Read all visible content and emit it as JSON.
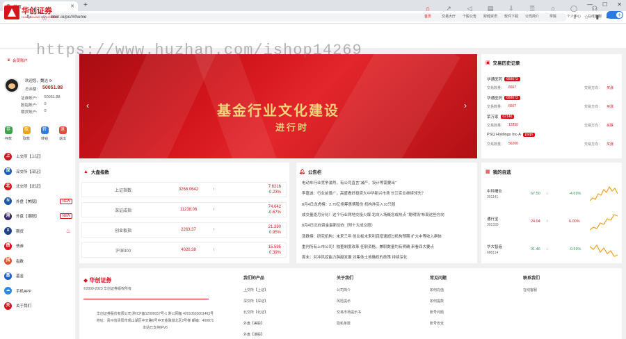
{
  "browser": {
    "tab_title": "首页",
    "url": "bbin.io/pc/#/home"
  },
  "header": {
    "logo_cn": "华创证券",
    "logo_en": "HUA CHUANG SECURITIES",
    "nav": [
      {
        "label": "首页",
        "icon": "home-icon"
      },
      {
        "label": "交易大厅",
        "icon": "chart-icon"
      },
      {
        "label": "个股公告",
        "icon": "megaphone-icon"
      },
      {
        "label": "财经资讯",
        "icon": "news-icon"
      },
      {
        "label": "软件下载",
        "icon": "download-icon"
      },
      {
        "label": "公司简介",
        "icon": "company-icon"
      },
      {
        "label": "学院",
        "icon": "graduation-icon"
      },
      {
        "label": "个人中心",
        "icon": "user-icon"
      },
      {
        "label": "在线客服",
        "icon": "support-icon"
      }
    ]
  },
  "watermark": "https://www.huzhan.com/ishop14269",
  "sidebar": {
    "account_title": "会员账户",
    "welcome": "欢迎您，魏洁",
    "total_label": "总余额:",
    "total_value": "50051.88",
    "rows": [
      {
        "label": "证券账户:",
        "value": "50051.88"
      },
      {
        "label": "股指账户:",
        "value": "0"
      },
      {
        "label": "期货账户:",
        "value": "0"
      }
    ],
    "quick_actions": [
      {
        "label": "存款",
        "glyph": "存",
        "color": "#3fa24a"
      },
      {
        "label": "取款",
        "glyph": "取",
        "color": "#e8a21b"
      },
      {
        "label": "转钱",
        "glyph": "转",
        "color": "#2f7bd8"
      },
      {
        "label": "退出",
        "glyph": "退",
        "color": "#e04b3a"
      }
    ],
    "items": [
      {
        "label": "上交所【上证】",
        "icon": "sse-icon",
        "color": "#c8161d",
        "glyph": "上"
      },
      {
        "label": "深交所【深证】",
        "icon": "szse-icon",
        "color": "#1d5fb8",
        "glyph": "深"
      },
      {
        "label": "北交所【北证】",
        "icon": "bse-icon",
        "color": "#d6141b",
        "glyph": "北"
      },
      {
        "label": "外盘【美股】",
        "icon": "us-stock-icon",
        "color": "#1a56a8",
        "glyph": "N",
        "badge": "NEW"
      },
      {
        "label": "外盘【港股】",
        "icon": "hk-stock-icon",
        "color": "#3a2a6a",
        "glyph": "港",
        "badge": "NEW"
      },
      {
        "label": "期货",
        "icon": "futures-icon",
        "color": "#1e3f8a",
        "glyph": "X",
        "hot": true
      },
      {
        "label": "债券",
        "icon": "bond-icon",
        "color": "#d6141b",
        "glyph": "债"
      },
      {
        "label": "指数",
        "icon": "index-icon",
        "color": "#e05530",
        "glyph": "指"
      },
      {
        "label": "基金",
        "icon": "fund-icon",
        "color": "#1a63c4",
        "glyph": "基"
      },
      {
        "label": "手机APP",
        "icon": "app-icon",
        "color": "#2e8ae0",
        "glyph": "☁"
      },
      {
        "label": "关于我们",
        "icon": "about-icon",
        "color": "#d6141b",
        "glyph": "关"
      }
    ]
  },
  "banner": {
    "title": "基金行业文化建设",
    "subtitle": "进行时"
  },
  "trade_history": {
    "title": "交易历史记录",
    "volume_label": "交易数量：",
    "direction_label": "交易方向：",
    "records": [
      {
        "name": "华通医药",
        "code": "688073",
        "volume": "6667",
        "direction": "买涨"
      },
      {
        "name": "华通医药",
        "code": "688073",
        "volume": "6667",
        "direction": "买涨"
      },
      {
        "name": "荣万家",
        "code": "02146",
        "volume": "12850",
        "direction": "买跌"
      },
      {
        "name": "PSQ Holdings Inc-A",
        "code": "psqh",
        "volume": "56200",
        "direction": "买涨"
      }
    ]
  },
  "market_index": {
    "title": "大盘指数",
    "rows": [
      {
        "name": "上证指数",
        "price": "3268.0642",
        "change": "7.6216",
        "pct": "0.23%"
      },
      {
        "name": "深证成指",
        "price": "11238.06",
        "change": "74.642",
        "pct": "-0.67%"
      },
      {
        "name": "创业板指",
        "price": "2263.37",
        "change": "21.390",
        "pct": "0.95%"
      },
      {
        "name": "沪深300",
        "price": "4020.38",
        "change": "15.595",
        "pct": "0.39%"
      }
    ]
  },
  "notice": {
    "title": "公告栏",
    "items": [
      "电动车行业竞争激烈，有公司直言“减产，设计等需要出”",
      "李嘉诚：行业前景广，高盛看好投资大中华新兴市场 长江实业继续领先？",
      "8月4日龙虎榜：2.79亿抢筹惠博股份 机构净买入10只股",
      "成交量逐月分化！这个行业两地交投火爆 北向入场概念成热点 “聪明钱”布局这些方向",
      "8月4日北向资金最新动向（附十大成交股）",
      "涨跌榜：研究机构：未来三年 创业板未来利润增速超过机构预期 扩大中等收入群体",
      "重判所有上市公司！独董制度改革 任职资格、兼职数量均有明确 来看四大要点",
      "周末：对冲风控能力跨越发展 对集体土地确权的政策 持续深化"
    ]
  },
  "watchlist": {
    "title": "我的自选",
    "items": [
      {
        "name": "中科曙业",
        "code": "301141",
        "price": "67.50",
        "pct": "-4.69%",
        "color": "#2e9a4a"
      },
      {
        "name": "通行宝",
        "code": "301339",
        "price": "24.04",
        "pct": "6.00%",
        "color": "#d6141b"
      },
      {
        "name": "华大智造",
        "code": "688114",
        "price": "91.46",
        "pct": "-0.59%",
        "color": "#2e9a4a"
      }
    ]
  },
  "footer": {
    "logo": "华创证券",
    "copyright": "©2009-2023 华创证券版权所有",
    "address_lines": [
      "华创证券股份有限公司 黔ICP备12000057号-1 黔公网备 42010602001463号",
      "地址：贵州省贵阳市观山湖区中天路6号中天金融城北区2号楼 邮编：400071",
      "本站已支持IPV6"
    ],
    "columns": [
      {
        "title": "我们的产品",
        "links": [
          "上交所【上证】",
          "深交所【深证】",
          "北交所【北证】",
          "外盘【美股】",
          "外盘【港股】"
        ]
      },
      {
        "title": "关于我们",
        "links": [
          "公司简介",
          "风险提示",
          "交易市场提示书",
          "隐私条款"
        ]
      },
      {
        "title": "常见问题",
        "links": [
          "如何充值",
          "如何提款",
          "账号问题",
          "账号安全"
        ]
      },
      {
        "title": "联系我们",
        "links": [
          "在线客服"
        ]
      }
    ]
  }
}
